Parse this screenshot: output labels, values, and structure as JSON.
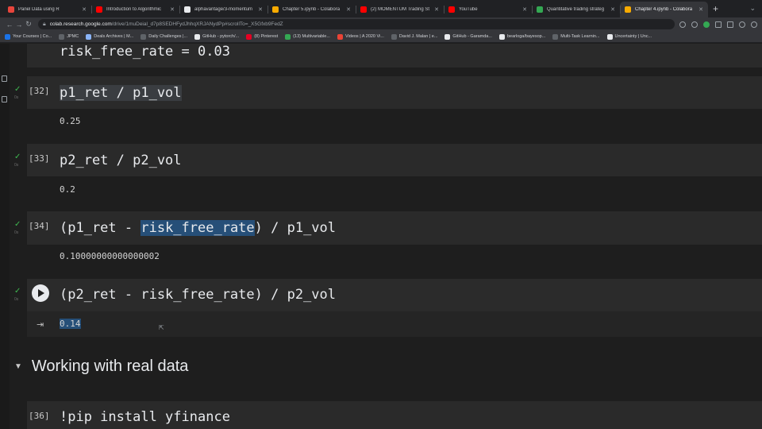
{
  "browser": {
    "tabs": [
      {
        "title": "Panel Data using R",
        "color": "#e8453c",
        "active": false
      },
      {
        "title": "Introduction to Algorithmic",
        "color": "#ff0000",
        "active": false
      },
      {
        "title": "alphavantage/3-momentum",
        "color": "#e8eaed",
        "active": false
      },
      {
        "title": "Chapter 5.ipynb - Colabora",
        "color": "#f9ab00",
        "active": false
      },
      {
        "title": "(2) MOMENTUM Trading St",
        "color": "#ff0000",
        "active": false
      },
      {
        "title": "YouTube",
        "color": "#ff0000",
        "active": false
      },
      {
        "title": "Quantitative trading strateg",
        "color": "#34a853",
        "active": false
      },
      {
        "title": "Chapter 4.ipynb - Colabora",
        "color": "#f9ab00",
        "active": true
      }
    ],
    "new_tab": "+",
    "url_host": "colab.research.google.com",
    "url_rest": "/drive/1muDeial_d7p8SEDHFydJhhqXRJANydPp#scrollTo=_X5Gfxb9FedZ"
  },
  "bookmarks": [
    {
      "label": "Your Courses | Co...",
      "color": "#1a73e8"
    },
    {
      "label": "JPMC",
      "color": "#5f6368"
    },
    {
      "label": "Deals Archives | M...",
      "color": "#8ab4f8"
    },
    {
      "label": "Daily Challenges |...",
      "color": "#5f6368"
    },
    {
      "label": "GitHub - pytorch/...",
      "color": "#e8eaed"
    },
    {
      "label": "(8) Pinterest",
      "color": "#e60023"
    },
    {
      "label": "(13) Multivariable...",
      "color": "#34a853"
    },
    {
      "label": "Videos | A 2020 Vi...",
      "color": "#ea4335"
    },
    {
      "label": "David J. Malan | e...",
      "color": "#5f6368"
    },
    {
      "label": "GitHub - Garamda...",
      "color": "#e8eaed"
    },
    {
      "label": "bearloga/bayesop...",
      "color": "#e8eaed"
    },
    {
      "label": "Multi-Task Learnin...",
      "color": "#5f6368"
    },
    {
      "label": "Uncertainty | Unc...",
      "color": "#e8eaed"
    }
  ],
  "notebook": {
    "partial_cell_code": "risk_free_rate = 0.03",
    "cells": [
      {
        "exec": "[32]",
        "code_a": "p1_ret / p1_vol",
        "output": "0.25"
      },
      {
        "exec": "[33]",
        "code_a": "p2_ret / p2_vol",
        "output": "0.2"
      },
      {
        "exec": "[34]",
        "code_pre": "(p1_ret - ",
        "code_hl": "risk_free_rate",
        "code_post": ") / p1_vol",
        "output": "0.10000000000000002"
      },
      {
        "code_pre": "(p2_ret - risk_free_rate",
        "code_post": ") / p2_vol",
        "output": "0.14"
      }
    ],
    "section_title": "Working with real data",
    "next_exec": "[36]",
    "next_code": "!pip install yfinance"
  }
}
